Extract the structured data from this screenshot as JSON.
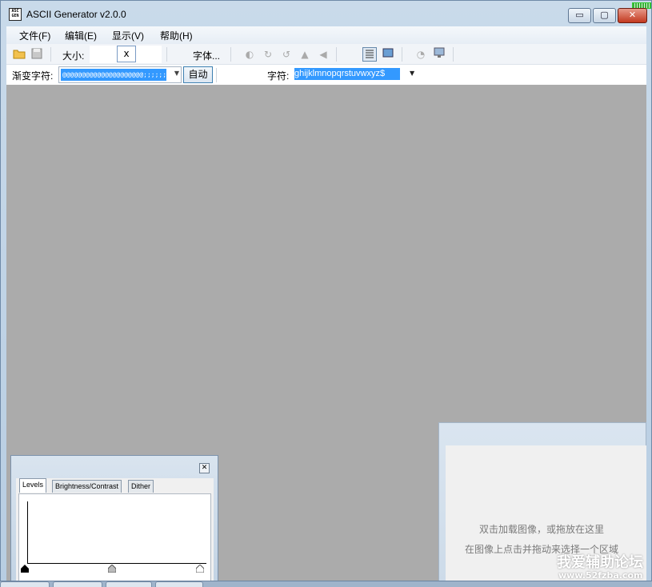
{
  "window": {
    "title": "ASCII Generator v2.0.0",
    "app_icon_text": "ASC\nGEN",
    "minimize_glyph": "▭",
    "maximize_glyph": "▢",
    "close_glyph": "✕"
  },
  "menu": {
    "items": [
      "文件(F)",
      "编辑(E)",
      "显示(V)",
      "帮助(H)"
    ]
  },
  "toolbar": {
    "size_label": "大小:",
    "size_separator": "x",
    "font_label": "字体...",
    "gradient_label": "渐变字符:",
    "gradient_value": "@@@@@@@@@@@@@@@@@@@@@;;;;;;;;;;;;;;;;;;;,,,,,,,,,,,,,,,,,",
    "auto_button": "自动",
    "chars_label": "字符:",
    "chars_value": "ghijklmnopqrstuvwxyz$"
  },
  "levels_panel": {
    "tabs": [
      "Levels",
      "Brightness/Contrast",
      "Dither"
    ],
    "active_tab": "Levels",
    "close_glyph": "✕"
  },
  "preview_panel": {
    "hint_line1": "双击加载图像，或拖放在这里",
    "hint_line2": "在图像上点击并拖动来选择一个区域"
  },
  "watermark": {
    "name": "我爱辅助论坛",
    "url": "www.52fzba.com"
  },
  "colors": {
    "canvas_bg": "#ababab",
    "selection": "#3399ff"
  }
}
